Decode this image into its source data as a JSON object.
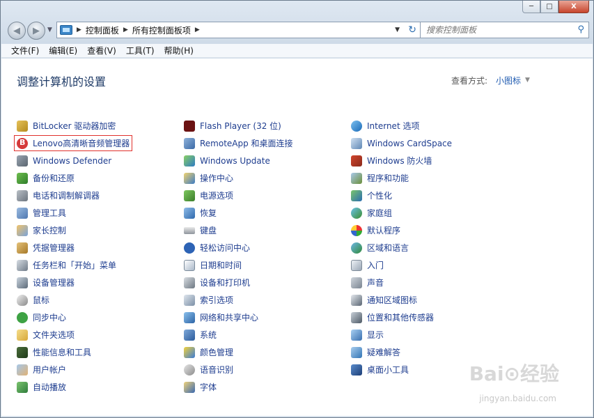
{
  "window": {
    "minimize": "─",
    "maximize": "□",
    "close": "X"
  },
  "address": {
    "segments": [
      "控制面板",
      "所有控制面板项"
    ]
  },
  "search": {
    "placeholder": "搜索控制面板"
  },
  "menu": {
    "items": [
      "文件(F)",
      "编辑(E)",
      "查看(V)",
      "工具(T)",
      "帮助(H)"
    ]
  },
  "header": {
    "title": "调整计算机的设置",
    "view_label": "查看方式:",
    "view_value": "小图标"
  },
  "columns": [
    [
      {
        "label": "BitLocker 驱动器加密",
        "icon": "bitlocker-icon"
      },
      {
        "label": "Lenovo高清晰音频管理器",
        "icon": "lenovo-audio-icon",
        "highlighted": true
      },
      {
        "label": "Windows Defender",
        "icon": "defender-icon"
      },
      {
        "label": "备份和还原",
        "icon": "backup-icon"
      },
      {
        "label": "电话和调制解调器",
        "icon": "phone-modem-icon"
      },
      {
        "label": "管理工具",
        "icon": "admin-tools-icon"
      },
      {
        "label": "家长控制",
        "icon": "parental-control-icon"
      },
      {
        "label": "凭据管理器",
        "icon": "credential-manager-icon"
      },
      {
        "label": "任务栏和「开始」菜单",
        "icon": "taskbar-icon"
      },
      {
        "label": "设备管理器",
        "icon": "device-manager-icon"
      },
      {
        "label": "鼠标",
        "icon": "mouse-icon"
      },
      {
        "label": "同步中心",
        "icon": "sync-center-icon"
      },
      {
        "label": "文件夹选项",
        "icon": "folder-options-icon"
      },
      {
        "label": "性能信息和工具",
        "icon": "performance-icon"
      },
      {
        "label": "用户帐户",
        "icon": "user-accounts-icon"
      },
      {
        "label": "自动播放",
        "icon": "autoplay-icon"
      }
    ],
    [
      {
        "label": "Flash Player (32 位)",
        "icon": "flash-player-icon"
      },
      {
        "label": "RemoteApp 和桌面连接",
        "icon": "remoteapp-icon"
      },
      {
        "label": "Windows Update",
        "icon": "windows-update-icon"
      },
      {
        "label": "操作中心",
        "icon": "action-center-icon"
      },
      {
        "label": "电源选项",
        "icon": "power-options-icon"
      },
      {
        "label": "恢复",
        "icon": "recovery-icon"
      },
      {
        "label": "键盘",
        "icon": "keyboard-icon"
      },
      {
        "label": "轻松访问中心",
        "icon": "ease-of-access-icon"
      },
      {
        "label": "日期和时间",
        "icon": "date-time-icon"
      },
      {
        "label": "设备和打印机",
        "icon": "devices-printers-icon"
      },
      {
        "label": "索引选项",
        "icon": "indexing-options-icon"
      },
      {
        "label": "网络和共享中心",
        "icon": "network-sharing-icon"
      },
      {
        "label": "系统",
        "icon": "system-icon"
      },
      {
        "label": "颜色管理",
        "icon": "color-management-icon"
      },
      {
        "label": "语音识别",
        "icon": "speech-recognition-icon"
      },
      {
        "label": "字体",
        "icon": "fonts-icon"
      }
    ],
    [
      {
        "label": "Internet 选项",
        "icon": "internet-options-icon"
      },
      {
        "label": "Windows CardSpace",
        "icon": "cardspace-icon"
      },
      {
        "label": "Windows 防火墙",
        "icon": "firewall-icon"
      },
      {
        "label": "程序和功能",
        "icon": "programs-features-icon"
      },
      {
        "label": "个性化",
        "icon": "personalization-icon"
      },
      {
        "label": "家庭组",
        "icon": "homegroup-icon"
      },
      {
        "label": "默认程序",
        "icon": "default-programs-icon"
      },
      {
        "label": "区域和语言",
        "icon": "region-language-icon"
      },
      {
        "label": "入门",
        "icon": "getting-started-icon"
      },
      {
        "label": "声音",
        "icon": "sound-icon"
      },
      {
        "label": "通知区域图标",
        "icon": "notification-area-icon"
      },
      {
        "label": "位置和其他传感器",
        "icon": "location-sensors-icon"
      },
      {
        "label": "显示",
        "icon": "display-icon"
      },
      {
        "label": "疑难解答",
        "icon": "troubleshooting-icon"
      },
      {
        "label": "桌面小工具",
        "icon": "desktop-gadgets-icon"
      }
    ]
  ],
  "watermark": {
    "text": "Bai⊙经验",
    "sub": "jingyan.baidu.com"
  }
}
